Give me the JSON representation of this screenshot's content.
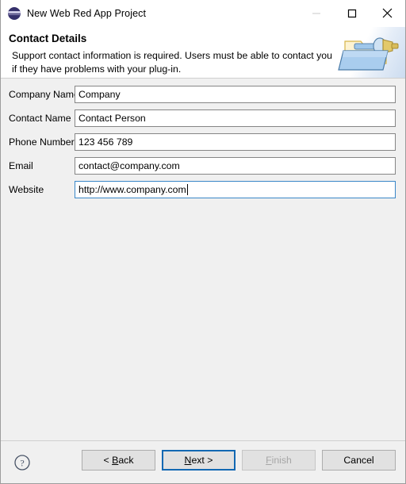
{
  "window": {
    "title": "New Web Red App Project",
    "icon": "eclipse-sphere-icon",
    "controls": {
      "minimize": "minimize-icon",
      "maximize": "maximize-icon",
      "close": "close-icon"
    }
  },
  "header": {
    "title": "Contact Details",
    "description": "Support contact information is required. Users must be able to contact you if they have problems with your plug-in.",
    "banner_icon": "folder-plugin-icon"
  },
  "form": {
    "fields": [
      {
        "label": "Company Name",
        "value": "Company",
        "name": "company-name",
        "focused": false
      },
      {
        "label": "Contact Name",
        "value": "Contact Person",
        "name": "contact-name",
        "focused": false
      },
      {
        "label": "Phone Number",
        "value": "123 456 789",
        "name": "phone-number",
        "focused": false
      },
      {
        "label": "Email",
        "value": "contact@company.com",
        "name": "email",
        "focused": false
      },
      {
        "label": "Website",
        "value": "http://www.company.com",
        "name": "website",
        "focused": true
      }
    ]
  },
  "buttonbar": {
    "help": "help-icon",
    "buttons": [
      {
        "label": "< Back",
        "mnemonic": "B",
        "state": "normal",
        "name": "back-button"
      },
      {
        "label": "Next >",
        "mnemonic": "N",
        "state": "default",
        "name": "next-button"
      },
      {
        "label": "Finish",
        "mnemonic": "F",
        "state": "disabled",
        "name": "finish-button"
      },
      {
        "label": "Cancel",
        "mnemonic": "",
        "state": "normal",
        "name": "cancel-button"
      }
    ]
  },
  "colors": {
    "accent_focus": "#1268b3",
    "input_border": "#858585",
    "body_bg": "#f0f0f0",
    "header_bg": "#ffffff",
    "disabled_text": "#a6a6a6"
  }
}
